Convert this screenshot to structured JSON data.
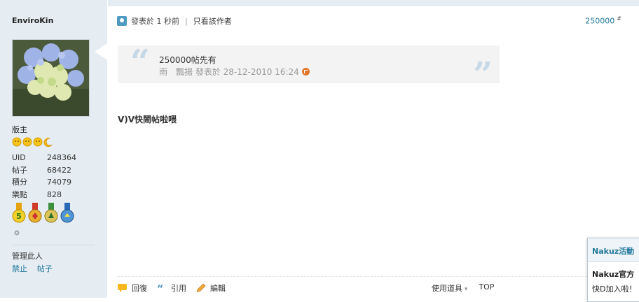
{
  "profile": {
    "username": "EnviroKin",
    "rank": "版主",
    "stats": [
      {
        "label": "UID",
        "value": "248364"
      },
      {
        "label": "帖子",
        "value": "68422"
      },
      {
        "label": "積分",
        "value": "74079"
      },
      {
        "label": "樂點",
        "value": "828"
      }
    ],
    "manage_label": "管理此人",
    "manage_links": [
      "禁止",
      "帖子"
    ]
  },
  "post": {
    "posted_time": "發表於 1 秒前",
    "only_author": "只看該作者",
    "floor": "250000",
    "floor_sup": "#",
    "quote": {
      "text": "250000帖先有",
      "source": "雨　飄揚 發表於 28-12-2010 16:24"
    },
    "body": "V)V快鬧帖啦喂"
  },
  "actions": {
    "reply": "回復",
    "quote": "引用",
    "edit": "編輯",
    "tools": "使用道具",
    "top": "TOP"
  },
  "notice": {
    "header": "Nakuz活動",
    "line1": "Nakuz官方",
    "line2": "快D加入啦！"
  },
  "colors": {
    "sidebar_bg": "#e5edf2",
    "link": "#22789c",
    "quote_bg": "#f3f3f3"
  }
}
